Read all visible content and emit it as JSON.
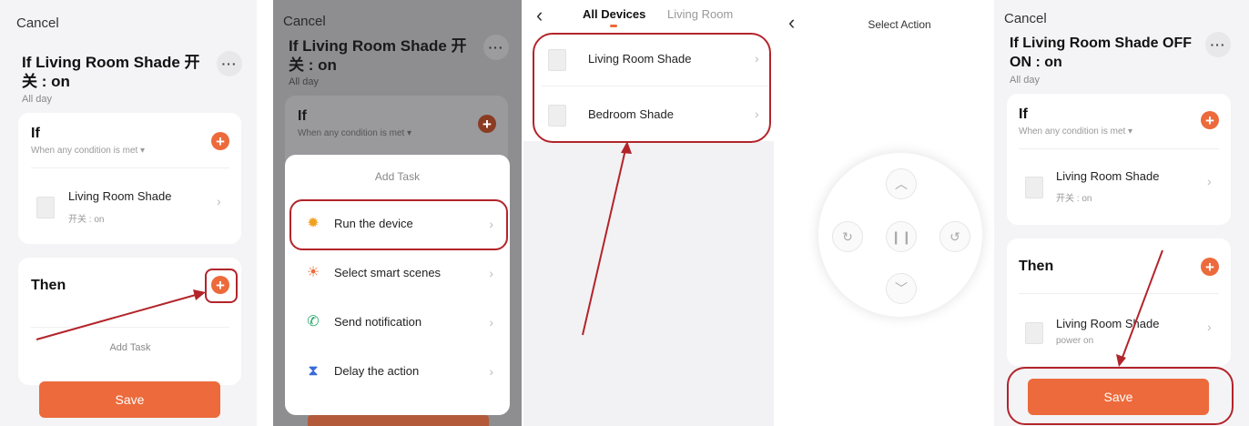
{
  "panel1": {
    "cancel": "Cancel",
    "title": "If Living Room Shade 开关 : on",
    "subtitle": "All day",
    "more": "···",
    "if_title": "If",
    "if_condition": "When any condition is met ▾",
    "device_name": "Living Room Shade",
    "device_state": "开关 : on",
    "then_title": "Then",
    "add_task": "Add Task",
    "save": "Save"
  },
  "panel2": {
    "cancel": "Cancel",
    "title": "If Living Room Shade 开 关 : on",
    "subtitle": "All day",
    "more": "···",
    "if_title": "If",
    "if_condition": "When any condition is met ▾",
    "sheet_title": "Add Task",
    "items": [
      {
        "label": "Run the device",
        "icon": "sun-device-icon"
      },
      {
        "label": "Select smart scenes",
        "icon": "sunrise-scene-icon"
      },
      {
        "label": "Send notification",
        "icon": "phone-message-icon"
      },
      {
        "label": "Delay the action",
        "icon": "hourglass-icon"
      }
    ]
  },
  "panel3": {
    "back": "‹",
    "tabs": [
      "All Devices",
      "Living Room"
    ],
    "devices": [
      "Living Room Shade",
      "Bedroom Shade"
    ]
  },
  "panel4": {
    "back": "‹",
    "title": "Select Action"
  },
  "panel5": {
    "cancel": "Cancel",
    "title_line1": "If Living Room Shade OFF",
    "title_line2": "ON : on",
    "subtitle": "All day",
    "more": "···",
    "if_title": "If",
    "if_condition": "When any condition is met ▾",
    "if_device_name": "Living Room Shade",
    "if_device_state": "开关 : on",
    "then_title": "Then",
    "then_device_name": "Living Room Shade",
    "then_device_state": "power on",
    "save": "Save"
  },
  "colors": {
    "accent": "#ec6a3b",
    "annotation": "#b3242a"
  }
}
